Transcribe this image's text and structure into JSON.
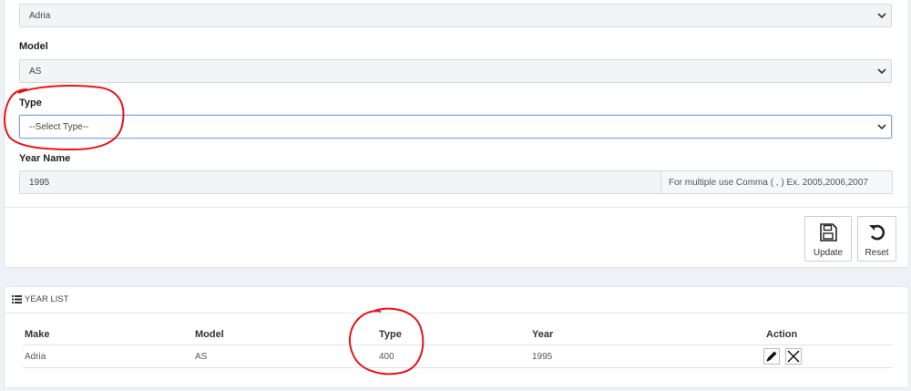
{
  "form": {
    "make": {
      "value": "Adria"
    },
    "model": {
      "label": "Model",
      "value": "AS"
    },
    "type": {
      "label": "Type",
      "value": "--Select Type--"
    },
    "year": {
      "label": "Year Name",
      "value": "1995",
      "hint": "For multiple use Comma ( , ) Ex. 2005,2006,2007"
    },
    "buttons": {
      "update": "Update",
      "reset": "Reset"
    }
  },
  "year_list": {
    "title": "YEAR LIST",
    "columns": {
      "make": "Make",
      "model": "Model",
      "type": "Type",
      "year": "Year",
      "action": "Action"
    },
    "rows": [
      {
        "make": "Adria",
        "model": "AS",
        "type": "400",
        "year": "1995"
      }
    ]
  },
  "colors": {
    "annotation": "#e8141b",
    "focus_border": "#7da9dc"
  },
  "icons": [
    "chevron-down-icon",
    "save-icon",
    "reset-icon",
    "list-icon",
    "pencil-icon",
    "close-icon"
  ]
}
